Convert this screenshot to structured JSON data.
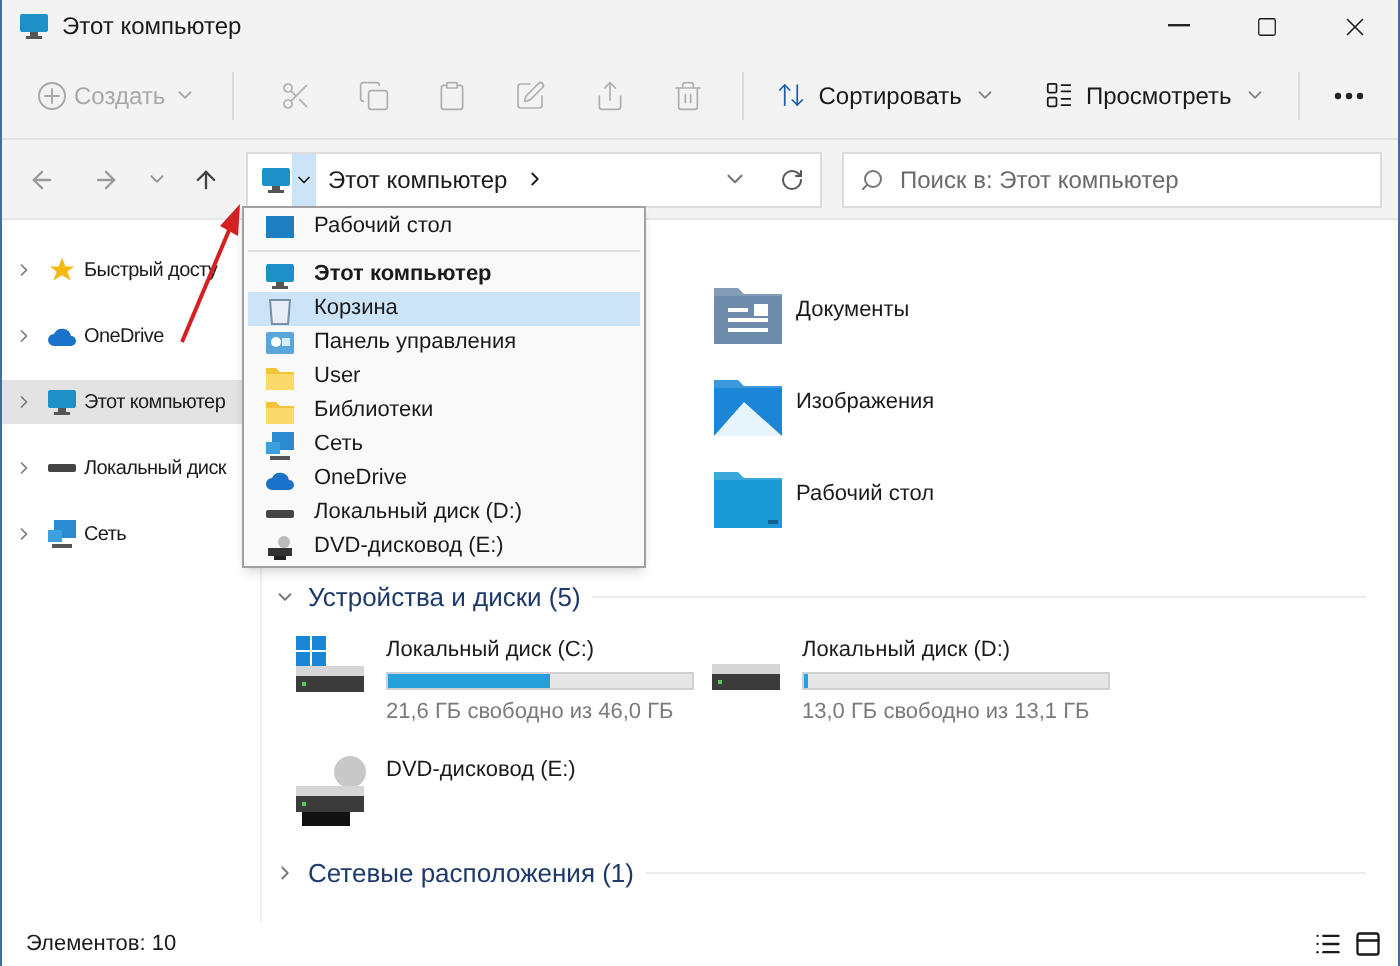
{
  "window": {
    "title": "Этот компьютер"
  },
  "toolbar": {
    "create": {
      "label": "Создать",
      "disabled": true
    },
    "actions": [
      {
        "kind": "cut",
        "disabled": true
      },
      {
        "kind": "copy",
        "disabled": true
      },
      {
        "kind": "paste",
        "disabled": true
      },
      {
        "kind": "rename",
        "disabled": true
      },
      {
        "kind": "share",
        "disabled": true
      },
      {
        "kind": "delete",
        "disabled": true
      }
    ],
    "sort": {
      "label": "Сортировать"
    },
    "view": {
      "label": "Просмотреть"
    }
  },
  "address": {
    "path": "Этот компьютер",
    "expanded": true
  },
  "search": {
    "placeholder": "Поиск в: Этот компьютер"
  },
  "sidebar": {
    "items": [
      {
        "label": "Быстрый досту",
        "kind": "star",
        "selected": false
      },
      {
        "label": "OneDrive",
        "kind": "cloud",
        "selected": false
      },
      {
        "label": "Этот компьютер",
        "kind": "pc",
        "selected": true
      },
      {
        "label": "Локальный диск",
        "kind": "drive",
        "selected": false
      },
      {
        "label": "Сеть",
        "kind": "network",
        "selected": false
      }
    ]
  },
  "dropdown": {
    "items": [
      {
        "label": "Рабочий стол",
        "kind": "desktop",
        "selected": false,
        "current": false
      },
      {
        "label": "Этот компьютер",
        "kind": "pc",
        "selected": false,
        "current": true
      },
      {
        "label": "Корзина",
        "kind": "bin",
        "selected": true,
        "current": false
      },
      {
        "label": "Панель управления",
        "kind": "control",
        "selected": false,
        "current": false
      },
      {
        "label": "User",
        "kind": "folder",
        "selected": false,
        "current": false
      },
      {
        "label": "Библиотеки",
        "kind": "folder",
        "selected": false,
        "current": false
      },
      {
        "label": "Сеть",
        "kind": "network",
        "selected": false,
        "current": false
      },
      {
        "label": "OneDrive",
        "kind": "cloud",
        "selected": false,
        "current": false
      },
      {
        "label": "Локальный диск (D:)",
        "kind": "drive",
        "selected": false,
        "current": false
      },
      {
        "label": "DVD-дисковод (E:)",
        "kind": "dvd",
        "selected": false,
        "current": false
      }
    ]
  },
  "folders": [
    {
      "label": "Документы",
      "kind": "documents"
    },
    {
      "label": "Изображения",
      "kind": "pictures"
    },
    {
      "label": "Рабочий стол",
      "kind": "desktop"
    }
  ],
  "devices": {
    "title": "Устройства и диски (5)",
    "expanded": true,
    "drives": [
      {
        "label": "Локальный диск (C:)",
        "kind": "system",
        "level": 0.53,
        "info": "21,6 ГБ свободно из 46,0 ГБ"
      },
      {
        "label": "Локальный диск (D:)",
        "kind": "disk",
        "level": 0.01,
        "info": "13,0 ГБ свободно из 13,1 ГБ"
      },
      {
        "label": "DVD-дисковод (E:)",
        "kind": "dvd"
      }
    ]
  },
  "network": {
    "title": "Сетевые расположения (1)",
    "expanded": false
  },
  "status_bar": {
    "text": "Элементов: 10"
  }
}
